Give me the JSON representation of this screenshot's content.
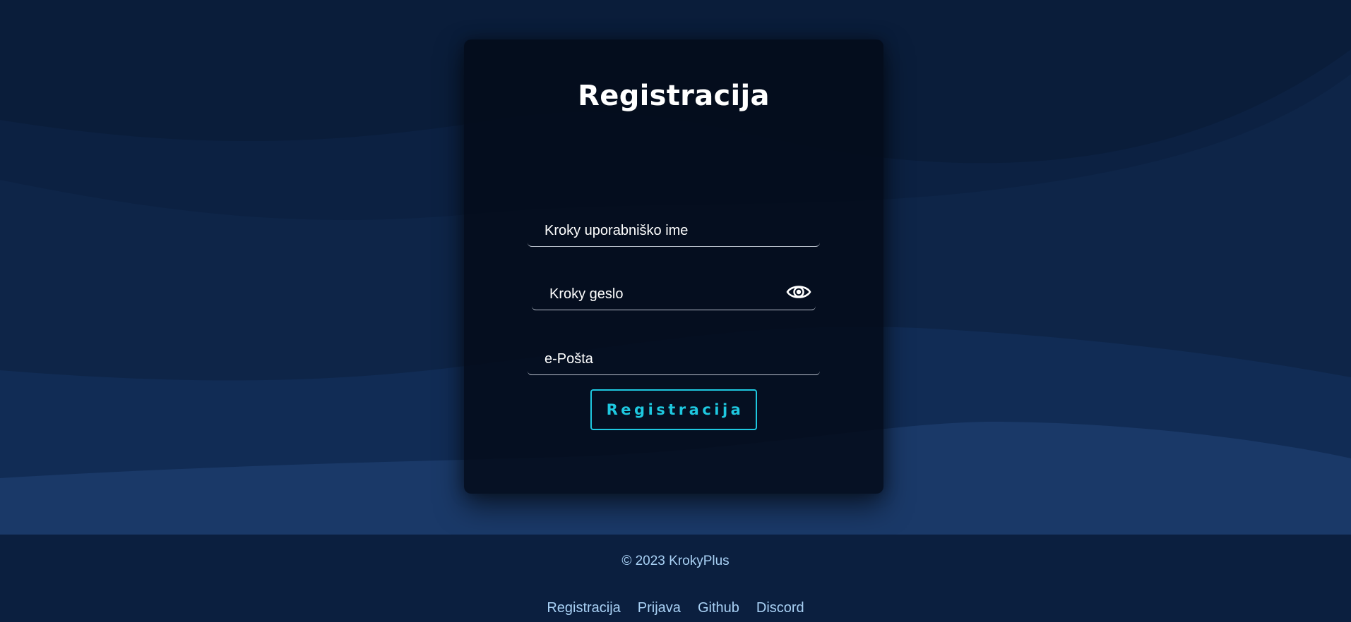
{
  "form": {
    "title": "Registracija",
    "username_placeholder": "Kroky uporabniško ime",
    "password_placeholder": "Kroky geslo",
    "email_placeholder": "e-Pošta",
    "submit_label": "Registracija",
    "password_toggle_icon": "eye-icon"
  },
  "footer": {
    "copyright": "© 2023 KrokyPlus",
    "links": [
      {
        "label": "Registracija"
      },
      {
        "label": "Prijava"
      },
      {
        "label": "Github"
      },
      {
        "label": "Discord"
      }
    ]
  },
  "colors": {
    "page_top": "#0a1d3a",
    "page_bottom": "#1a3968",
    "card": "#030a18",
    "accent": "#1ec8e0",
    "footer_bg": "#0b1f3f",
    "footer_text": "#a9d1f5"
  }
}
